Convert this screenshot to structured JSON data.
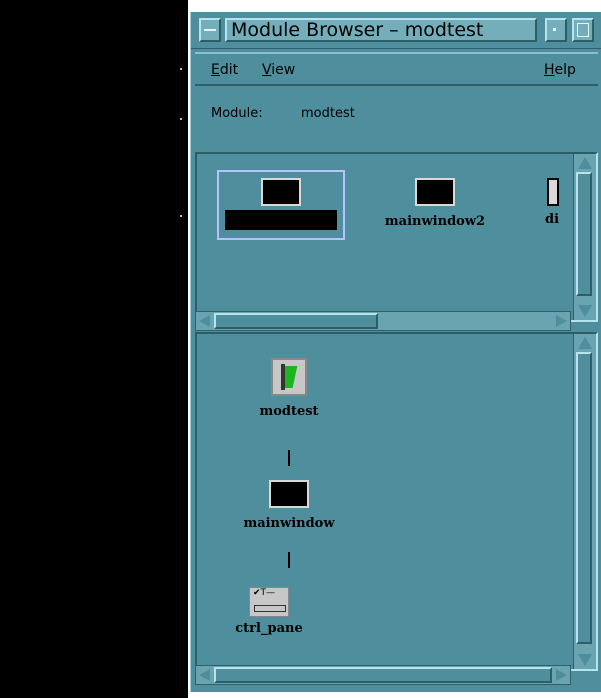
{
  "window": {
    "title": "Module Browser – modtest"
  },
  "menubar": {
    "edit": {
      "mnemonic": "E",
      "rest": "dit"
    },
    "view": {
      "mnemonic": "V",
      "rest": "iew"
    },
    "help": {
      "mnemonic": "H",
      "rest": "elp"
    }
  },
  "module": {
    "label": "Module:",
    "value": "modtest"
  },
  "module_list": {
    "items": [
      {
        "label": "",
        "selected": true,
        "icon": "window-icon"
      },
      {
        "label": "mainwindow2",
        "icon": "window-icon"
      },
      {
        "label": "di",
        "icon": "window-icon"
      }
    ]
  },
  "tree": {
    "nodes": [
      {
        "label": "modtest",
        "icon": "module-icon"
      },
      {
        "label": "mainwindow",
        "icon": "window-icon"
      },
      {
        "label": "ctrl_pane",
        "icon": "control-pane-icon",
        "icon_text": "✔T—"
      }
    ]
  },
  "colors": {
    "window_bg": "#4f8e9c",
    "selection": "#b8c2ff"
  }
}
